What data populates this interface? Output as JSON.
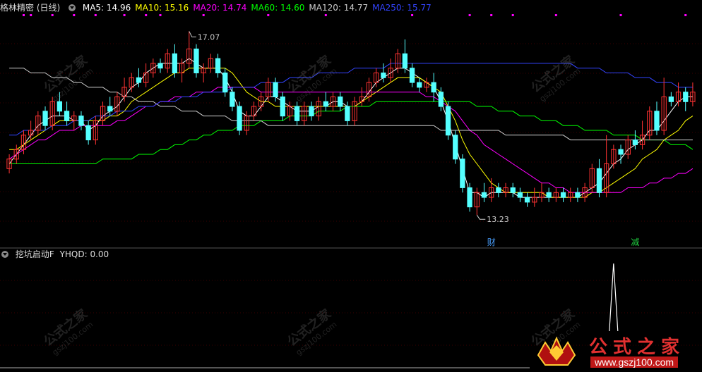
{
  "header": {
    "stock_name": "格林精密 (日线)",
    "ma_labels": [
      {
        "label": "MA5: 14.96",
        "color": "#ffffff"
      },
      {
        "label": "MA10: 15.16",
        "color": "#ffff00"
      },
      {
        "label": "MA20: 14.74",
        "color": "#ff00ff"
      },
      {
        "label": "MA60: 14.60",
        "color": "#00ff00"
      },
      {
        "label": "MA120: 14.77",
        "color": "#cccccc"
      },
      {
        "label": "MA250: 15.77",
        "color": "#3344ff"
      }
    ]
  },
  "indicator": {
    "title": "挖坑启动F",
    "value_label": "YHQD: 0.00"
  },
  "colors": {
    "up": "#ff3232",
    "down": "#54ffff",
    "ma5": "#ffffff",
    "ma10": "#ffff00",
    "ma20": "#ff00ff",
    "ma60": "#00ff00",
    "ma120": "#cccccc",
    "ma250": "#3344ff",
    "grid": "#3a0000"
  },
  "watermark": {
    "text": "公式之家",
    "url": "gszj100.com"
  },
  "logo": {
    "title": "公式之家",
    "url": "www.gszj100.com"
  },
  "chart_data": {
    "type": "candlestick",
    "ylim": [
      12.6,
      17.4
    ],
    "high_label": "17.07",
    "low_label": "13.23",
    "candles": [
      [
        14.2,
        14.4,
        14.5,
        14.1
      ],
      [
        14.4,
        14.6,
        14.7,
        14.3
      ],
      [
        14.6,
        14.9,
        15.0,
        14.5
      ],
      [
        14.9,
        15.0,
        15.2,
        14.8
      ],
      [
        15.0,
        15.3,
        15.4,
        14.9
      ],
      [
        15.4,
        15.1,
        15.5,
        15.0
      ],
      [
        15.1,
        15.6,
        15.7,
        15.0
      ],
      [
        15.6,
        15.4,
        15.8,
        15.3
      ],
      [
        15.4,
        15.2,
        15.6,
        15.1
      ],
      [
        15.2,
        15.3,
        15.4,
        15.0
      ],
      [
        15.3,
        15.1,
        15.4,
        15.0
      ],
      [
        15.1,
        14.8,
        15.2,
        14.7
      ],
      [
        14.8,
        15.2,
        15.3,
        14.7
      ],
      [
        15.2,
        15.5,
        15.6,
        15.1
      ],
      [
        15.5,
        15.4,
        15.7,
        15.3
      ],
      [
        15.4,
        15.7,
        15.8,
        15.3
      ],
      [
        15.7,
        15.9,
        16.1,
        15.6
      ],
      [
        15.9,
        16.1,
        16.2,
        15.8
      ],
      [
        16.1,
        16.0,
        16.3,
        15.9
      ],
      [
        16.0,
        16.2,
        16.4,
        15.9
      ],
      [
        16.2,
        16.4,
        16.5,
        16.1
      ],
      [
        16.4,
        16.3,
        16.5,
        16.2
      ],
      [
        16.3,
        16.6,
        16.7,
        16.2
      ],
      [
        16.6,
        16.2,
        16.8,
        16.1
      ],
      [
        16.2,
        16.4,
        16.5,
        16.0
      ],
      [
        16.4,
        16.7,
        17.07,
        16.3
      ],
      [
        16.7,
        16.2,
        16.8,
        16.1
      ],
      [
        16.2,
        16.3,
        16.4,
        16.0
      ],
      [
        16.3,
        16.5,
        16.6,
        16.2
      ],
      [
        16.5,
        16.2,
        16.6,
        16.1
      ],
      [
        16.2,
        15.8,
        16.3,
        15.7
      ],
      [
        15.8,
        15.5,
        15.9,
        15.4
      ],
      [
        15.5,
        15.0,
        15.6,
        14.9
      ],
      [
        15.0,
        15.3,
        15.4,
        14.9
      ],
      [
        15.3,
        15.5,
        15.6,
        15.2
      ],
      [
        15.5,
        15.7,
        15.8,
        15.4
      ],
      [
        15.7,
        16.0,
        16.1,
        15.6
      ],
      [
        16.0,
        15.7,
        16.1,
        15.6
      ],
      [
        15.7,
        15.3,
        15.8,
        15.2
      ],
      [
        15.3,
        15.5,
        15.6,
        15.2
      ],
      [
        15.5,
        15.2,
        15.6,
        15.1
      ],
      [
        15.2,
        15.5,
        15.6,
        15.1
      ],
      [
        15.5,
        15.3,
        15.6,
        15.2
      ],
      [
        15.3,
        15.6,
        15.7,
        15.2
      ],
      [
        15.6,
        15.5,
        15.8,
        15.4
      ],
      [
        15.5,
        15.7,
        15.8,
        15.4
      ],
      [
        15.7,
        15.5,
        15.8,
        15.4
      ],
      [
        15.5,
        15.2,
        15.6,
        15.1
      ],
      [
        15.2,
        15.6,
        15.7,
        15.1
      ],
      [
        15.6,
        15.7,
        15.9,
        15.5
      ],
      [
        15.7,
        16.0,
        16.1,
        15.6
      ],
      [
        16.0,
        16.2,
        16.3,
        15.9
      ],
      [
        16.2,
        16.1,
        16.4,
        16.0
      ],
      [
        16.1,
        16.3,
        16.5,
        16.0
      ],
      [
        16.3,
        16.6,
        16.7,
        16.2
      ],
      [
        16.6,
        16.3,
        16.9,
        16.2
      ],
      [
        16.3,
        16.0,
        16.4,
        15.9
      ],
      [
        16.0,
        15.9,
        16.1,
        15.8
      ],
      [
        15.9,
        16.0,
        16.1,
        15.8
      ],
      [
        16.0,
        15.8,
        16.2,
        15.6
      ],
      [
        15.8,
        15.5,
        15.9,
        15.4
      ],
      [
        15.5,
        14.9,
        15.6,
        14.8
      ],
      [
        14.9,
        14.4,
        15.0,
        14.3
      ],
      [
        14.4,
        13.8,
        14.5,
        13.7
      ],
      [
        13.8,
        13.4,
        13.9,
        13.3
      ],
      [
        13.4,
        13.7,
        13.8,
        13.23
      ],
      [
        13.7,
        13.6,
        13.9,
        13.5
      ],
      [
        13.6,
        13.8,
        14.0,
        13.5
      ],
      [
        13.8,
        13.7,
        13.9,
        13.6
      ],
      [
        13.7,
        13.8,
        13.9,
        13.6
      ],
      [
        13.8,
        13.7,
        13.9,
        13.6
      ],
      [
        13.7,
        13.6,
        13.8,
        13.5
      ],
      [
        13.6,
        13.5,
        13.7,
        13.4
      ],
      [
        13.5,
        13.6,
        13.8,
        13.4
      ],
      [
        13.6,
        13.7,
        13.9,
        13.5
      ],
      [
        13.7,
        13.6,
        13.8,
        13.5
      ],
      [
        13.6,
        13.7,
        13.8,
        13.5
      ],
      [
        13.7,
        13.6,
        13.8,
        13.5
      ],
      [
        13.6,
        13.7,
        13.8,
        13.5
      ],
      [
        13.7,
        13.6,
        13.8,
        13.5
      ],
      [
        13.6,
        13.8,
        13.9,
        13.5
      ],
      [
        13.8,
        14.2,
        14.3,
        13.7
      ],
      [
        14.2,
        13.7,
        14.4,
        13.6
      ],
      [
        13.7,
        14.3,
        14.9,
        13.6
      ],
      [
        14.3,
        14.6,
        14.7,
        14.2
      ],
      [
        14.6,
        14.5,
        14.7,
        14.3
      ],
      [
        14.5,
        14.8,
        14.9,
        14.4
      ],
      [
        14.8,
        14.7,
        15.0,
        14.6
      ],
      [
        14.7,
        14.9,
        15.2,
        14.6
      ],
      [
        14.9,
        15.4,
        15.5,
        14.8
      ],
      [
        15.4,
        15.0,
        15.6,
        14.9
      ],
      [
        15.0,
        15.7,
        16.1,
        14.9
      ],
      [
        15.7,
        15.6,
        15.8,
        15.5
      ],
      [
        15.6,
        15.8,
        16.0,
        15.5
      ],
      [
        15.8,
        15.6,
        15.9,
        15.4
      ],
      [
        15.6,
        15.8,
        16.0,
        15.5
      ]
    ],
    "ma": [
      {
        "name": "MA5",
        "color": "#ffffff",
        "values": [
          14.3,
          14.5,
          14.7,
          14.9,
          15.1,
          15.2,
          15.3,
          15.3,
          15.3,
          15.2,
          15.2,
          15.0,
          15.1,
          15.3,
          15.4,
          15.5,
          15.7,
          15.9,
          16.0,
          16.2,
          16.3,
          16.4,
          16.4,
          16.4,
          16.4,
          16.5,
          16.4,
          16.3,
          16.3,
          16.3,
          16.1,
          15.8,
          15.4,
          15.3,
          15.3,
          15.5,
          15.7,
          15.7,
          15.6,
          15.5,
          15.4,
          15.4,
          15.4,
          15.5,
          15.5,
          15.6,
          15.6,
          15.5,
          15.5,
          15.6,
          15.8,
          16.0,
          16.1,
          16.2,
          16.3,
          16.3,
          16.2,
          16.1,
          16.0,
          15.9,
          15.6,
          15.2,
          14.7,
          14.2,
          13.7,
          13.7,
          13.6,
          13.7,
          13.7,
          13.7,
          13.7,
          13.6,
          13.6,
          13.6,
          13.6,
          13.6,
          13.6,
          13.6,
          13.6,
          13.6,
          13.7,
          13.8,
          13.9,
          14.1,
          14.3,
          14.4,
          14.6,
          14.7,
          14.8,
          15.0,
          15.0,
          15.2,
          15.4,
          15.6,
          15.7,
          15.7
        ]
      },
      {
        "name": "MA10",
        "color": "#ffff00",
        "values": [
          14.6,
          14.6,
          14.7,
          14.8,
          14.9,
          15.0,
          15.1,
          15.2,
          15.2,
          15.2,
          15.2,
          15.2,
          15.2,
          15.2,
          15.3,
          15.3,
          15.4,
          15.6,
          15.7,
          15.8,
          15.9,
          16.0,
          16.1,
          16.2,
          16.2,
          16.3,
          16.3,
          16.3,
          16.3,
          16.3,
          16.3,
          16.2,
          16.0,
          15.8,
          15.7,
          15.6,
          15.6,
          15.5,
          15.5,
          15.5,
          15.5,
          15.5,
          15.5,
          15.5,
          15.5,
          15.5,
          15.5,
          15.5,
          15.5,
          15.6,
          15.7,
          15.8,
          15.9,
          16.0,
          16.1,
          16.1,
          16.1,
          16.1,
          16.0,
          15.9,
          15.8,
          15.5,
          15.2,
          14.8,
          14.5,
          14.3,
          14.1,
          13.9,
          13.8,
          13.7,
          13.7,
          13.7,
          13.7,
          13.7,
          13.7,
          13.6,
          13.6,
          13.6,
          13.6,
          13.6,
          13.6,
          13.7,
          13.7,
          13.8,
          13.9,
          14.0,
          14.1,
          14.2,
          14.4,
          14.5,
          14.6,
          14.8,
          14.9,
          15.0,
          15.2,
          15.3
        ]
      },
      {
        "name": "MA20",
        "color": "#ff00ff",
        "values": [
          14.4,
          14.5,
          14.6,
          14.7,
          14.8,
          14.8,
          14.9,
          15.0,
          15.0,
          15.0,
          15.1,
          15.1,
          15.1,
          15.1,
          15.1,
          15.2,
          15.2,
          15.3,
          15.4,
          15.5,
          15.5,
          15.6,
          15.6,
          15.7,
          15.7,
          15.7,
          15.8,
          15.8,
          15.8,
          15.9,
          15.9,
          15.9,
          15.9,
          15.9,
          15.9,
          15.8,
          15.8,
          15.8,
          15.8,
          15.8,
          15.8,
          15.8,
          15.8,
          15.8,
          15.8,
          15.8,
          15.8,
          15.8,
          15.8,
          15.8,
          15.8,
          15.8,
          15.8,
          15.8,
          15.8,
          15.8,
          15.8,
          15.8,
          15.7,
          15.7,
          15.6,
          15.5,
          15.4,
          15.2,
          15.0,
          14.9,
          14.7,
          14.6,
          14.5,
          14.4,
          14.3,
          14.2,
          14.1,
          14.0,
          13.9,
          13.9,
          13.8,
          13.8,
          13.7,
          13.7,
          13.7,
          13.7,
          13.7,
          13.7,
          13.7,
          13.7,
          13.8,
          13.8,
          13.8,
          13.9,
          13.9,
          14.0,
          14.0,
          14.1,
          14.1,
          14.2
        ]
      },
      {
        "name": "MA60",
        "color": "#00ff00",
        "values": [
          14.3,
          14.3,
          14.3,
          14.3,
          14.3,
          14.3,
          14.3,
          14.3,
          14.3,
          14.3,
          14.3,
          14.3,
          14.3,
          14.4,
          14.4,
          14.4,
          14.4,
          14.4,
          14.5,
          14.5,
          14.5,
          14.6,
          14.6,
          14.7,
          14.7,
          14.8,
          14.8,
          14.9,
          14.9,
          15.0,
          15.0,
          15.0,
          15.1,
          15.1,
          15.1,
          15.2,
          15.2,
          15.2,
          15.2,
          15.3,
          15.3,
          15.3,
          15.3,
          15.4,
          15.4,
          15.4,
          15.4,
          15.5,
          15.5,
          15.5,
          15.5,
          15.6,
          15.6,
          15.6,
          15.6,
          15.6,
          15.6,
          15.6,
          15.6,
          15.6,
          15.6,
          15.6,
          15.6,
          15.6,
          15.6,
          15.5,
          15.5,
          15.5,
          15.4,
          15.4,
          15.4,
          15.3,
          15.3,
          15.3,
          15.2,
          15.2,
          15.2,
          15.1,
          15.1,
          15.1,
          15.0,
          15.0,
          15.0,
          15.0,
          14.9,
          14.9,
          14.9,
          14.9,
          14.8,
          14.8,
          14.8,
          14.8,
          14.7,
          14.7,
          14.7,
          14.6
        ]
      },
      {
        "name": "MA120",
        "color": "#cccccc",
        "values": [
          16.3,
          16.3,
          16.3,
          16.2,
          16.2,
          16.2,
          16.1,
          16.1,
          16.1,
          16.0,
          16.0,
          15.9,
          15.9,
          15.9,
          15.8,
          15.8,
          15.7,
          15.7,
          15.6,
          15.6,
          15.6,
          15.5,
          15.5,
          15.5,
          15.4,
          15.4,
          15.4,
          15.3,
          15.3,
          15.3,
          15.3,
          15.2,
          15.2,
          15.2,
          15.2,
          15.2,
          15.1,
          15.1,
          15.1,
          15.1,
          15.1,
          15.1,
          15.1,
          15.1,
          15.1,
          15.1,
          15.1,
          15.1,
          15.1,
          15.1,
          15.1,
          15.1,
          15.1,
          15.1,
          15.1,
          15.1,
          15.1,
          15.1,
          15.1,
          15.1,
          15.0,
          15.0,
          15.0,
          15.0,
          15.0,
          15.0,
          15.0,
          15.0,
          15.0,
          14.9,
          14.9,
          14.9,
          14.9,
          14.9,
          14.9,
          14.9,
          14.9,
          14.9,
          14.8,
          14.8,
          14.8,
          14.8,
          14.8,
          14.8,
          14.8,
          14.8,
          14.8,
          14.8,
          14.8,
          14.8,
          14.8,
          14.8,
          14.8,
          14.8,
          14.8,
          14.8
        ]
      },
      {
        "name": "MA250",
        "color": "#3344ff",
        "values": [
          14.9,
          14.9,
          15.0,
          15.0,
          15.0,
          15.0,
          15.1,
          15.1,
          15.1,
          15.2,
          15.2,
          15.2,
          15.3,
          15.3,
          15.3,
          15.4,
          15.4,
          15.4,
          15.5,
          15.5,
          15.5,
          15.6,
          15.6,
          15.6,
          15.7,
          15.7,
          15.7,
          15.8,
          15.8,
          15.8,
          15.8,
          15.9,
          15.9,
          15.9,
          15.9,
          16.0,
          16.0,
          16.0,
          16.0,
          16.1,
          16.1,
          16.1,
          16.1,
          16.2,
          16.2,
          16.2,
          16.2,
          16.2,
          16.3,
          16.3,
          16.3,
          16.3,
          16.3,
          16.4,
          16.4,
          16.4,
          16.4,
          16.4,
          16.4,
          16.4,
          16.4,
          16.4,
          16.4,
          16.4,
          16.4,
          16.4,
          16.4,
          16.4,
          16.4,
          16.4,
          16.4,
          16.4,
          16.4,
          16.4,
          16.4,
          16.4,
          16.4,
          16.4,
          16.4,
          16.3,
          16.3,
          16.3,
          16.3,
          16.2,
          16.2,
          16.2,
          16.2,
          16.1,
          16.1,
          16.1,
          16.0,
          16.0,
          16.0,
          15.9,
          15.9,
          15.9
        ]
      }
    ],
    "annotations": [
      {
        "index": 67,
        "text": "财",
        "color": "#4aa0ff"
      },
      {
        "index": 87,
        "text": "减",
        "color": "#20d040"
      }
    ],
    "top_markers": [
      2,
      3,
      6,
      9,
      12,
      16,
      19,
      21,
      27,
      36,
      44,
      56,
      64,
      67,
      70,
      76,
      85,
      94
    ],
    "indicator_spike_index": 84,
    "indicator_spike_value": 1.0
  }
}
